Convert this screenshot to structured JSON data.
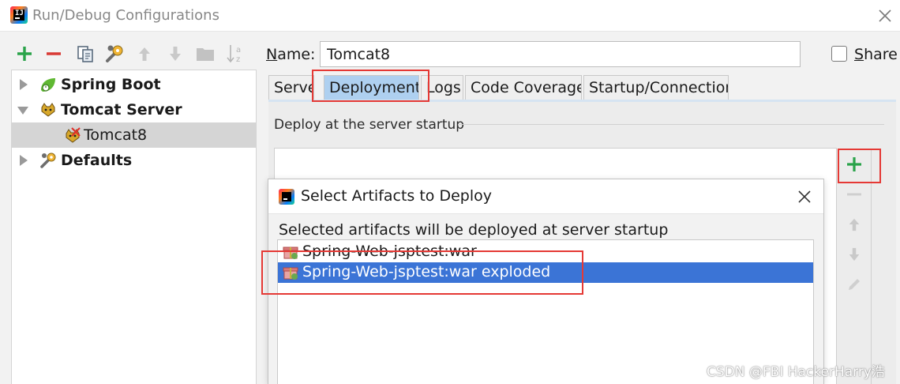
{
  "window": {
    "title": "Run/Debug Configurations"
  },
  "toolbar": {
    "icons": [
      "add-icon",
      "remove-icon",
      "copy-icon",
      "wrench-icon",
      "move-up-icon",
      "move-down-icon",
      "folder-icon",
      "sort-icon"
    ]
  },
  "tree": {
    "items": [
      {
        "label": "Spring Boot",
        "expanded": false,
        "icon": "spring-boot-icon"
      },
      {
        "label": "Tomcat Server",
        "expanded": true,
        "icon": "tomcat-icon"
      },
      {
        "label": "Tomcat8",
        "selected": true,
        "icon": "tomcat-error-icon"
      },
      {
        "label": "Defaults",
        "expanded": false,
        "icon": "wrench-icon"
      }
    ]
  },
  "config": {
    "name_label_first": "N",
    "name_label_rest": "ame:",
    "name_value": "Tomcat8",
    "share_first": "S",
    "share_rest": "hare"
  },
  "tabs": [
    {
      "label": "Server",
      "active": false
    },
    {
      "label": "Deployment",
      "active": true
    },
    {
      "label": "Logs",
      "active": false
    },
    {
      "label": "Code Coverage",
      "active": false
    },
    {
      "label": "Startup/Connection",
      "active": false
    }
  ],
  "deployment": {
    "section_label": "Deploy at the server startup"
  },
  "dialog": {
    "title": "Select Artifacts to Deploy",
    "description": "Selected artifacts will be deployed at server startup",
    "artifacts": [
      {
        "label": "Spring-Web-jsptest:war",
        "selected": false
      },
      {
        "label": "Spring-Web-jsptest:war exploded",
        "selected": true
      }
    ]
  },
  "colors": {
    "accent_green": "#2aa34a",
    "accent_red": "#d93a35",
    "selection_blue": "#3b74d6",
    "active_tab": "#aed0f0",
    "highlight_box": "#e53935"
  },
  "watermark": "CSDN @FBI HackerHarry浩"
}
